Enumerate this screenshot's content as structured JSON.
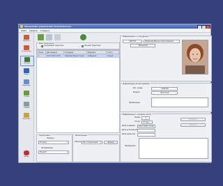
{
  "window": {
    "title": "Программа управления (исполнитель)"
  },
  "menu": [
    "Файл",
    "Правка",
    "Справка"
  ],
  "sidebar": [
    {
      "label": "Персонал",
      "color": "#c0603a"
    },
    {
      "label": "Регистрация",
      "color": "#d0553a"
    },
    {
      "label": "Путевые",
      "color": "#3e7a36"
    },
    {
      "label": "Заявки",
      "color": "#2f63b5"
    },
    {
      "label": "Маршруты",
      "color": "#6a8fd0"
    },
    {
      "label": "Отчёты",
      "color": "#6a9a3a"
    },
    {
      "label": "Справки",
      "color": "#8a9aa0"
    },
    {
      "label": "Настройки",
      "color": "#c8a23a"
    },
    {
      "label": "Выход",
      "color": "#c03030"
    }
  ],
  "toolbar": {
    "add": "Добавить",
    "edit": "Изменить",
    "delete": "Удалить",
    "refresh": "Обновить"
  },
  "transport": {
    "title": "Вид транспорта",
    "option1": "Служебный транспорт",
    "option2": "Личный транспорт"
  },
  "table": {
    "headers": [
      "Номер",
      "Дата выдачи",
      "Сотрудник",
      "Водитель",
      "Статус"
    ],
    "rows": [
      {
        "num": "1",
        "date": "18.07.2012 13:28",
        "employee": "Абрамова Ирина Станис",
        "driver": "Сибиряков",
        "status": "Открыт"
      }
    ]
  },
  "filters": {
    "sort_title": "Сортировка",
    "sort_label": "Порядок",
    "sort_value": "По дате",
    "group_title": "Направление",
    "group_value": "По дате",
    "filter_title": "Фильтрация",
    "filter_label": "Период",
    "filter_value": "Без ограничений",
    "filter_button": "Фильтр"
  },
  "employee": {
    "title": "Информация о сотруднике",
    "id": "095744",
    "name": "Абрамова Ирина Станиславовна",
    "position": "Менеджер"
  },
  "car": {
    "title": "Информация об автомобиле",
    "plate_label": "Рег. номер",
    "plate": "С046 ВО",
    "model_label": "Модель",
    "model": "ВАЗ 2110",
    "note_label": "Примечание"
  },
  "waybill": {
    "title": "Информация о путевом листе",
    "number_label": "Номер",
    "number": "1",
    "status_label": "Статус",
    "status": "Открыт",
    "created_label": "Дата создания",
    "created": "18.07.2012 13:28",
    "issued_label": "Дата исполнения",
    "closed_label": "Дата закрытия",
    "note_label": "Примечание",
    "btn_cancel": "Отменить",
    "btn_close": "Закрыть"
  }
}
